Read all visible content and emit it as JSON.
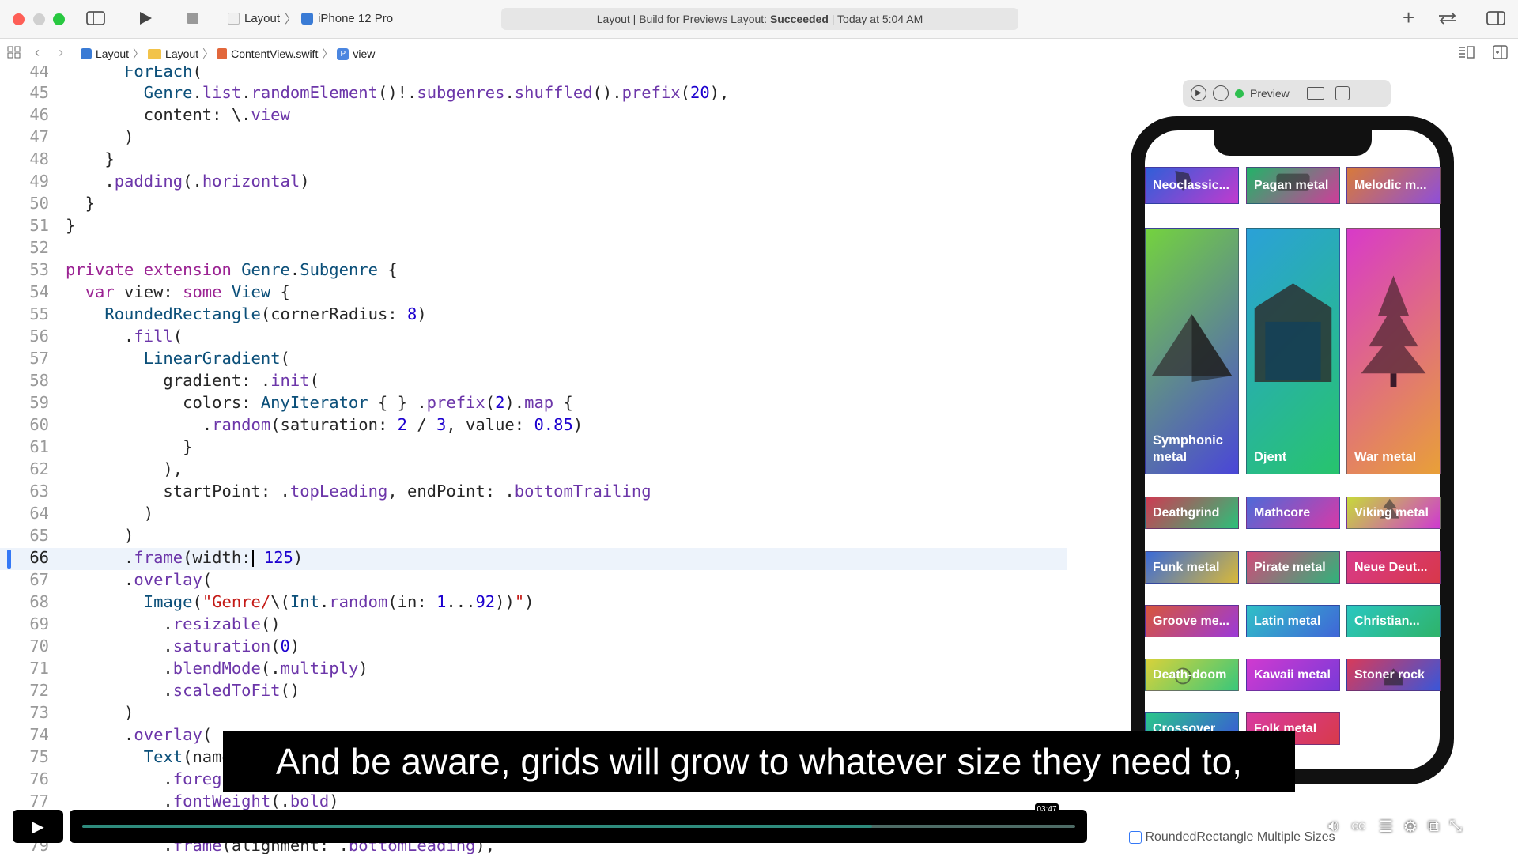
{
  "toolbar": {
    "scheme_project": "Layout",
    "scheme_device": "iPhone 12 Pro",
    "status_prefix": "Layout | Build for Previews Layout: ",
    "status_result": "Succeeded",
    "status_suffix": " | Today at 5:04 AM"
  },
  "breadcrumb": [
    "Layout",
    "Layout",
    "ContentView.swift",
    "view"
  ],
  "preview": {
    "label": "Preview"
  },
  "tiles": [
    {
      "label": "Neoclassic...",
      "c1": "#2f5fd8",
      "c2": "#c03bcf",
      "icon": "horse"
    },
    {
      "label": "Pagan metal",
      "c1": "#22b368",
      "c2": "#cf3d9a",
      "icon": "jeep"
    },
    {
      "label": "Melodic m...",
      "c1": "#d87a3a",
      "c2": "#8f4fd8",
      "icon": "none"
    },
    {
      "label": "Symphonic metal",
      "c1": "#74d33e",
      "c2": "#4a46d8",
      "icon": "pyramid"
    },
    {
      "label": "Djent",
      "c1": "#2aa1d8",
      "c2": "#27c46d",
      "icon": "garage"
    },
    {
      "label": "War metal",
      "c1": "#d83ac9",
      "c2": "#e8a038",
      "icon": "tree"
    },
    {
      "label": "Deathgrind",
      "c1": "#cf3a52",
      "c2": "#2bc07a",
      "icon": "none"
    },
    {
      "label": "Mathcore",
      "c1": "#4d6ad8",
      "c2": "#d63aa8",
      "icon": "none"
    },
    {
      "label": "Viking metal",
      "c1": "#c7d93a",
      "c2": "#cf3ad0",
      "icon": "tree2"
    },
    {
      "label": "Funk metal",
      "c1": "#3a6ad8",
      "c2": "#d8b93a",
      "icon": "none"
    },
    {
      "label": "Pirate metal",
      "c1": "#d14a7a",
      "c2": "#2fb37a",
      "icon": "none"
    },
    {
      "label": "Neue Deut...",
      "c1": "#d83a8a",
      "c2": "#d8384a",
      "icon": "none"
    },
    {
      "label": "Groove me...",
      "c1": "#d8563a",
      "c2": "#9c3ad8",
      "icon": "none"
    },
    {
      "label": "Latin metal",
      "c1": "#2fc0c7",
      "c2": "#4066d8",
      "icon": "none"
    },
    {
      "label": "Christian...",
      "c1": "#2ac7c0",
      "c2": "#2fb36a",
      "icon": "none"
    },
    {
      "label": "Death-doom",
      "c1": "#d8d23a",
      "c2": "#3ac77a",
      "icon": "sun"
    },
    {
      "label": "Kawaii metal",
      "c1": "#d03ad0",
      "c2": "#7a3ad8",
      "icon": "none"
    },
    {
      "label": "Stoner rock",
      "c1": "#d83a5a",
      "c2": "#3a56d8",
      "icon": "house"
    },
    {
      "label": "Crossover",
      "c1": "#2ac78a",
      "c2": "#3a56d8",
      "icon": "none"
    },
    {
      "label": "Folk metal",
      "c1": "#d83aa0",
      "c2": "#d83a4a",
      "icon": "none"
    }
  ],
  "caption": "And be aware, grids will grow to whatever size they need to,",
  "player": {
    "time": "03:47",
    "progress": 0.795
  },
  "bottom_label": "RoundedRectangle  Multiple Sizes"
}
